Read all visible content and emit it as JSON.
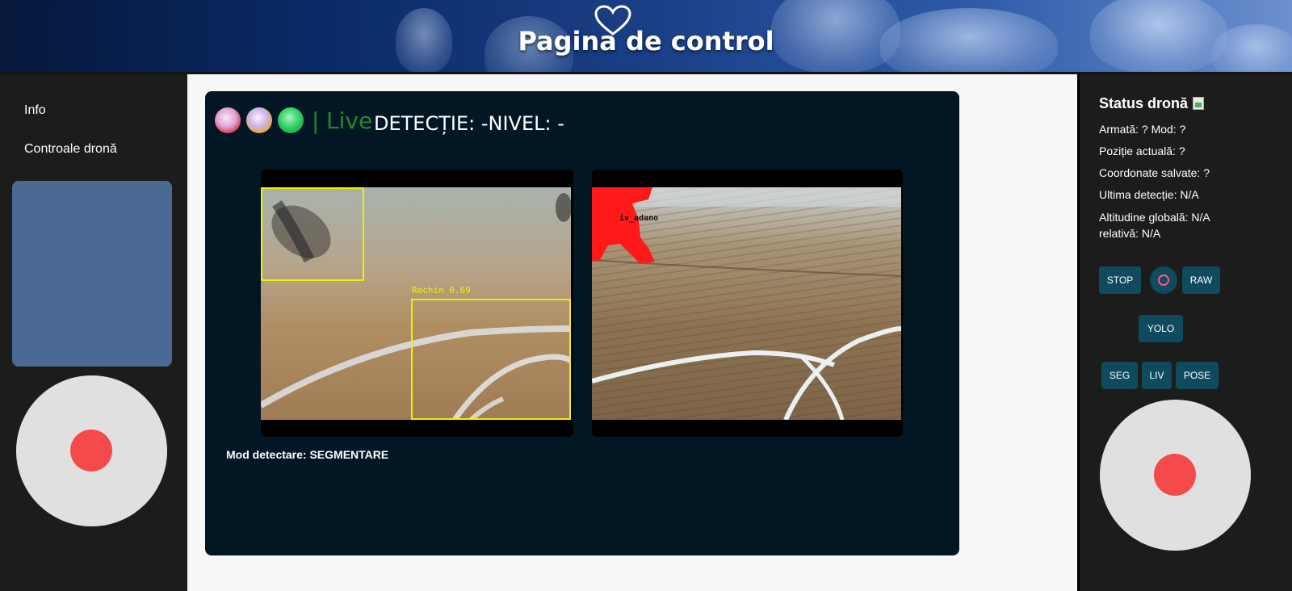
{
  "header": {
    "title": "Pagina de control"
  },
  "sidebar": {
    "items": [
      {
        "label": "Info"
      },
      {
        "label": "Controale dronă"
      }
    ]
  },
  "live": {
    "separator": "|",
    "label": "Live",
    "detection_label": "DETECȚIE: -NIVEL: -",
    "left_box_label": "Rechin 0.69",
    "right_seg_label": "iv_adano",
    "mode_text": "Mod detectare: SEGMENTARE"
  },
  "status": {
    "title": "Status dronă",
    "armed_mode": "Armată: ? Mod: ?",
    "position": "Poziție actuală: ?",
    "saved_coords": "Coordonate salvate: ?",
    "last_detection": "Ultima detecție: N/A",
    "altitude": "Altitudine globală: N/A relativă: N/A"
  },
  "controls": {
    "stop": "STOP",
    "raw": "RAW",
    "yolo": "YOLO",
    "seg": "SEG",
    "liv": "LIV",
    "pose": "POSE"
  },
  "colors": {
    "accent_button": "#0f4a5f",
    "joystick_knob": "#f44a4a",
    "live_green": "#1f8a2f",
    "bbox_yellow": "#f0f000",
    "panel_blue": "#4a6a93",
    "video_bg": "#021624"
  }
}
